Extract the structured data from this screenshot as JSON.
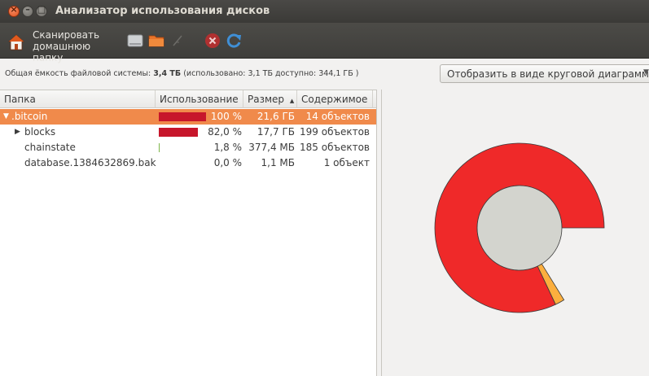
{
  "window": {
    "title": "Анализатор использования дисков"
  },
  "toolbar": {
    "scan_home_label": "Сканировать домашнюю папку",
    "icons": [
      "home-icon",
      "drive-icon",
      "folder-icon",
      "network-icon",
      "stop-icon",
      "refresh-icon"
    ]
  },
  "infobar": {
    "prefix": "Общая ёмкость файловой системы:",
    "total": "3,4 ТБ",
    "detail": "(использовано: 3,1 ТБ доступно: 344,1 ГБ )"
  },
  "view_button": {
    "label": "Отобразить в виде круговой диаграммы"
  },
  "table": {
    "headers": {
      "folder": "Папка",
      "usage": "Использование",
      "size": "Размер",
      "size_sort": "▲",
      "contents": "Содержимое"
    },
    "rows": [
      {
        "name": ".bitcoin",
        "expander": "▼",
        "usage_fraction": 1.0,
        "percent": "100 %",
        "size": "21,6 ГБ",
        "contents": "14 объектов",
        "selected": true
      },
      {
        "name": "blocks",
        "expander": "▶",
        "usage_fraction": 0.82,
        "percent": "82,0 %",
        "size": "17,7 ГБ",
        "contents": "199 объектов",
        "selected": false
      },
      {
        "name": "chainstate",
        "expander": "",
        "usage_fraction": 0.018,
        "percent": "1,8 %",
        "size": "377,4 МБ",
        "contents": "185 объектов",
        "selected": false
      },
      {
        "name": "database.1384632869.bak",
        "expander": "",
        "usage_fraction": 0.0,
        "percent": "0,0 %",
        "size": "1,1 МБ",
        "contents": "1 объект",
        "selected": false
      }
    ]
  },
  "ring_chart": {
    "center_color": "#d3d4ce",
    "segments": [
      {
        "fraction": 0.82,
        "color": "#ef2929"
      },
      {
        "fraction": 0.018,
        "color": "#fcaf3e"
      }
    ]
  }
}
